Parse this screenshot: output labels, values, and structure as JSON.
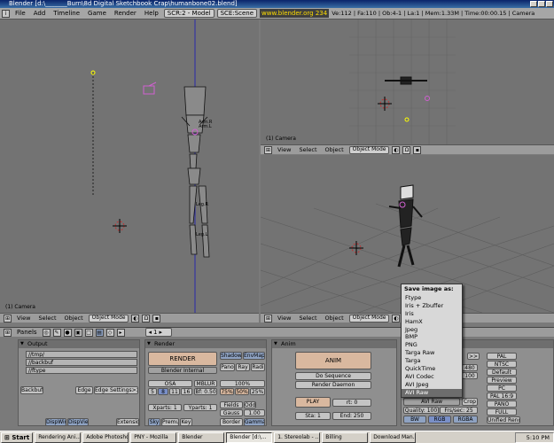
{
  "window": {
    "title": "Blender [d:\\_______Burn\\8d Digital Sketchbook Crap\\humanbone02.blend]"
  },
  "mainheader": {
    "menus": [
      "File",
      "Add",
      "Timeline",
      "Game",
      "Render",
      "Help"
    ],
    "screen": "SCR:2 - Model",
    "scene": "SCE:Scene",
    "website": "www.blender.org 234",
    "info": "Ve:112 | Fa:110 | Ob:4-1 | La:1 | Mem:1.33M | Time:00:00.15 | Camera"
  },
  "viewports": {
    "left": {
      "label": "(1) Camera"
    },
    "topright": {
      "label": "(1) Camera"
    },
    "bottomright": {
      "label": "(1) Camera"
    },
    "armature_labels": [
      "Arm.R",
      "Arm.L",
      "Leg.R",
      "Leg.L"
    ],
    "header": {
      "menus": [
        "View",
        "Select",
        "Object"
      ],
      "mode": "Object Mode"
    }
  },
  "buttons": {
    "header": {
      "menu": "Panels",
      "frame": "1"
    },
    "output": {
      "title": "Output",
      "paths": [
        "//tmp/",
        "//backbuf",
        "//ftype"
      ],
      "backbuf": "Backbuf",
      "edge": "Edge",
      "edge_settings": "Edge Settings>>",
      "disp_win": "DispWin",
      "disp_view": "DispView",
      "extensions": "Extensio"
    },
    "render": {
      "title": "Render",
      "render_btn": "RENDER",
      "engine": "Blender Internal",
      "shadow": "Shadow",
      "envmap": "EnvMap",
      "pano": "Pano",
      "ray": "Ray",
      "radio": "Radi",
      "osa": "OSA",
      "mblur": "MBLUR",
      "osa_levels": [
        "5",
        "8",
        "11",
        "16"
      ],
      "bf": "Bf: 0.50",
      "pct": "100%",
      "pct_options": [
        "75%",
        "50%",
        "25%"
      ],
      "xparts": "Xparts: 1",
      "yparts": "Yparts: 1",
      "fields": "Fields",
      "odd": "Odd",
      "gauss": "Gauss",
      "gauss_val": "1.00",
      "sky": "Sky",
      "premul": "Premul",
      "key": "Key",
      "border": "Border",
      "gamma": "Gamma"
    },
    "anim": {
      "title": "Anim",
      "anim_btn": "ANIM",
      "do_sequence": "Do Sequence",
      "render_daemon": "Render Daemon",
      "play": "PLAY",
      "rt": "rt: 0",
      "sta": "Sta: 1",
      "end": "End: 250"
    },
    "format": {
      "sizex": "480",
      "sizey": "100",
      "more": ">>",
      "presets": [
        "PAL",
        "NTSC",
        "Default",
        "Preview",
        "PC",
        "PAL 16:9",
        "PANO",
        "FULL",
        "Unified Rend"
      ],
      "selected_format": "AVI Raw",
      "crop": "Crop",
      "quality": "Quality: 100",
      "fps": "Frs/sec: 25",
      "bw": "BW",
      "rgb": "RGB",
      "rgba": "RGBA"
    }
  },
  "saveas_menu": {
    "title": "Save image as:",
    "items": [
      "Ftype",
      "Iris + Zbuffer",
      "Iris",
      "HamX",
      "Jpeg",
      "BMP",
      "PNG",
      "Targa Raw",
      "Targa",
      "QuickTime",
      "AVI Codec",
      "AVI Jpeg",
      "AVI Raw"
    ],
    "highlighted": "AVI Raw"
  },
  "taskbar": {
    "start": "Start",
    "tasks": [
      "Rendering Ani...",
      "Adobe Photoshop",
      "PNY - Mozilla",
      "Blender",
      "Blender [d:\\...",
      "1. Stereolab - ...",
      "Billing",
      "Download Man..."
    ],
    "active_task": 4,
    "clock": "5:10 PM"
  },
  "colors": {
    "viewport_bg": "#737373",
    "header_bg": "#a6a6a6",
    "menu_highlight": "#6d6d6d",
    "selected_blue": "#7a90c8"
  }
}
